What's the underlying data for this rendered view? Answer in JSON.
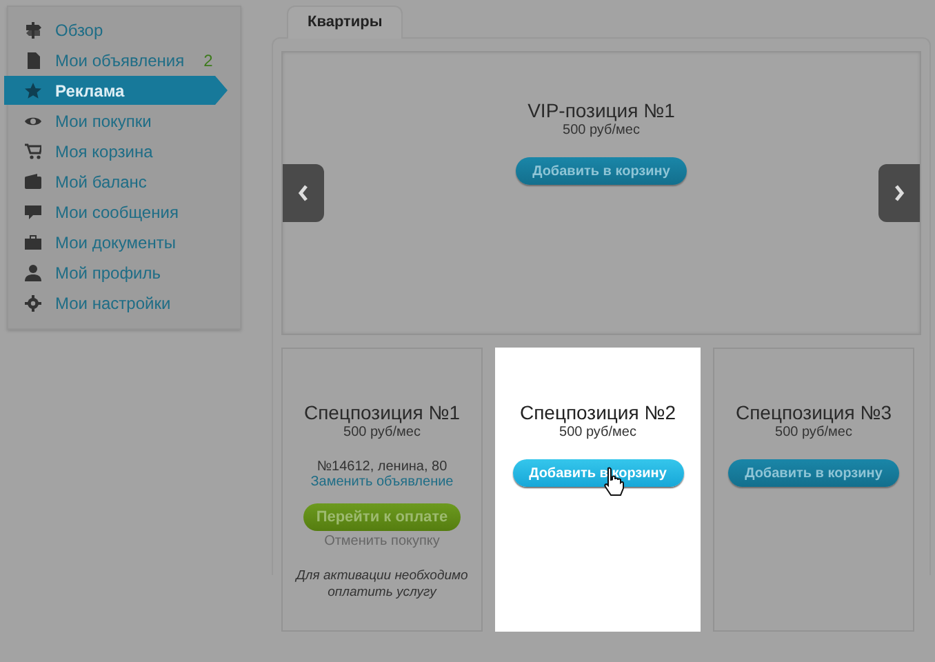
{
  "sidebar": {
    "items": [
      {
        "label": "Обзор",
        "selected": false
      },
      {
        "label": "Мои объявления",
        "badge": "2",
        "selected": false
      },
      {
        "label": "Реклама",
        "selected": true
      },
      {
        "label": "Мои покупки",
        "selected": false
      },
      {
        "label": "Моя корзина",
        "selected": false
      },
      {
        "label": "Мой баланс",
        "selected": false
      },
      {
        "label": "Мои сообщения",
        "selected": false
      },
      {
        "label": "Мои документы",
        "selected": false
      },
      {
        "label": "Мой профиль",
        "selected": false
      },
      {
        "label": "Мои настройки",
        "selected": false
      }
    ]
  },
  "tabs": [
    {
      "label": "Квартиры",
      "selected": true
    }
  ],
  "vip": {
    "title": "VIP-позиция №1",
    "price": "500 руб/мес",
    "add_button": "Добавить в корзину"
  },
  "cards": [
    {
      "title": "Спецпозиция №1",
      "price": "500 руб/мес",
      "highlighted": false,
      "listing": "№14612, ленина, 80",
      "replace_link": "Заменить объявление",
      "pay_button": "Перейти к оплате",
      "cancel_link": "Отменить покупку",
      "note": "Для активации необходимо оплатить услугу"
    },
    {
      "title": "Спецпозиция №2",
      "price": "500 руб/мес",
      "highlighted": true,
      "add_button": "Добавить в корзину"
    },
    {
      "title": "Спецпозиция №3",
      "price": "500 руб/мес",
      "highlighted": false,
      "add_button": "Добавить в корзину"
    }
  ]
}
